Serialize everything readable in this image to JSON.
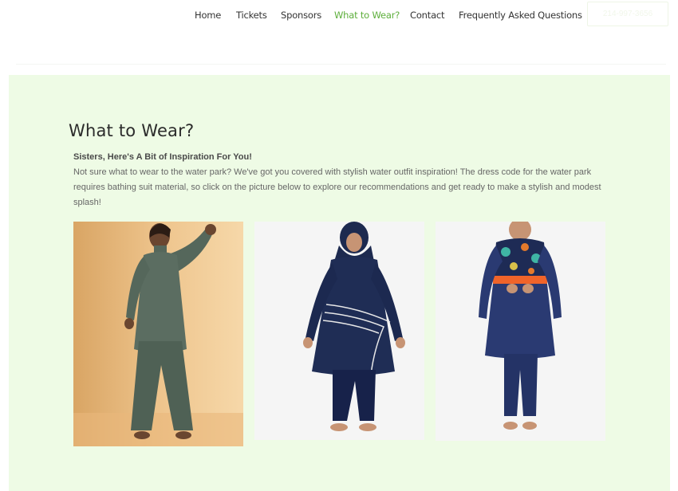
{
  "nav": {
    "items": [
      {
        "label": "Home"
      },
      {
        "label": "Tickets"
      },
      {
        "label": "Sponsors"
      },
      {
        "label": "What to Wear?"
      },
      {
        "label": "Contact"
      },
      {
        "label": "Frequently Asked Questions"
      }
    ],
    "phone": "214-997-3656"
  },
  "main": {
    "title": "What to Wear?",
    "subtitle": "Sisters, Here's A Bit of Inspiration For You!",
    "body": "Not sure what to wear to the water park? We've got you covered with stylish water outfit inspiration! The dress code for the water park requires bathing suit material, so click on the picture below to explore our recommendations and get ready to make a stylish and modest splash!"
  },
  "colors": {
    "accent": "#5cae3a",
    "section_bg": "#eefbe5"
  }
}
